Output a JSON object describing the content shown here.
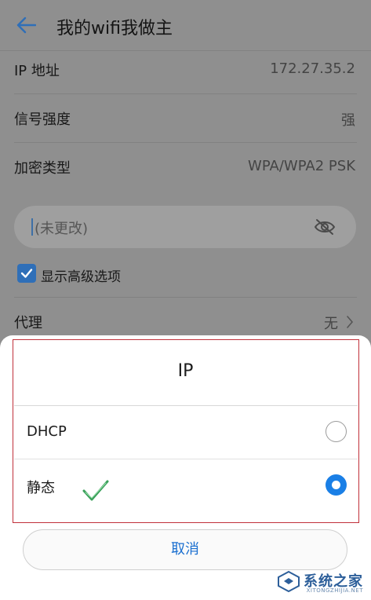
{
  "header": {
    "title": "我的wifi我做主",
    "back_icon": "arrow-left-icon"
  },
  "rows": [
    {
      "label": "IP 地址",
      "value": "172.27.35.2"
    },
    {
      "label": "信号强度",
      "value": "强"
    },
    {
      "label": "加密类型",
      "value": "WPA/WPA2 PSK"
    }
  ],
  "password": {
    "placeholder": "(未更改)",
    "toggle_icon": "eye-off-icon"
  },
  "advanced": {
    "label": "显示高级选项",
    "checked": true
  },
  "proxy": {
    "label": "代理",
    "value": "无"
  },
  "dialog": {
    "title": "IP",
    "options": [
      {
        "label": "DHCP",
        "selected": false
      },
      {
        "label": "静态",
        "selected": true
      }
    ],
    "cancel_label": "取消"
  },
  "watermark": {
    "text": "系统之家",
    "sub": "XITONGZHIJIA.NET"
  },
  "colors": {
    "accent": "#1a7fe6",
    "highlight": "#c0303a",
    "dim_background": "#8f8f8f"
  }
}
